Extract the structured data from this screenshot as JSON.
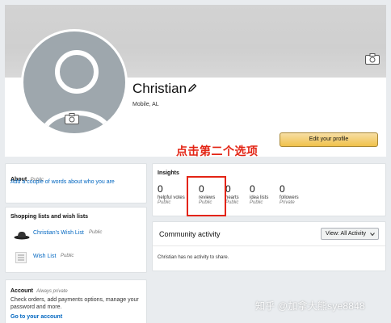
{
  "profile": {
    "name": "Christian",
    "location": "Mobile, AL",
    "edit_button": "Edit your profile"
  },
  "annotation": {
    "text": "点击第二个选项",
    "color": "#e32414"
  },
  "about": {
    "title": "About",
    "visibility": "Public",
    "link": "Add a couple of words about who you are"
  },
  "shopping": {
    "title": "Shopping lists and wish lists",
    "lists": [
      {
        "name": "Christian's Wish List",
        "visibility": "Public",
        "icon": "hat-icon"
      },
      {
        "name": "Wish List",
        "visibility": "Public",
        "icon": "list-icon"
      }
    ]
  },
  "account": {
    "title": "Account",
    "visibility": "Always private",
    "desc": "Check orders, add payments options, manage your password and more.",
    "link": "Go to your account"
  },
  "insights": {
    "title": "Insights",
    "stats": [
      {
        "value": "0",
        "label": "helpful votes",
        "visibility": "Public"
      },
      {
        "value": "0",
        "label": "reviews",
        "visibility": "Public"
      },
      {
        "value": "0",
        "label": "hearts",
        "visibility": "Public"
      },
      {
        "value": "0",
        "label": "idea lists",
        "visibility": "Public"
      },
      {
        "value": "0",
        "label": "followers",
        "visibility": "Private"
      }
    ]
  },
  "activity": {
    "title": "Community activity",
    "filter": "View: All Activity",
    "empty": "Christian has no activity to share."
  },
  "watermark": "知乎 @加拿大熊sye8848",
  "colors": {
    "button": "#f0c14b",
    "link": "#0066c0",
    "annotation": "#e32414",
    "avatar": "#9ea7ad"
  }
}
